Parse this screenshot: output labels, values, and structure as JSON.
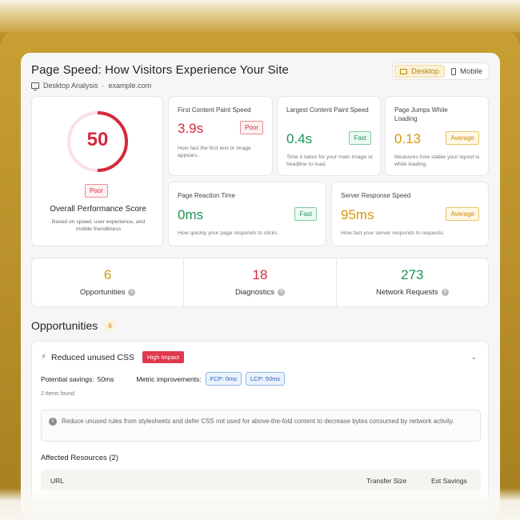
{
  "header": {
    "title": "Page Speed: How Visitors Experience Your Site",
    "analysis_label": "Desktop Analysis",
    "separator": "·",
    "domain": "example.com"
  },
  "device_toggle": {
    "options": [
      "Desktop",
      "Mobile"
    ],
    "selected": "Desktop"
  },
  "score": {
    "value": "50",
    "fraction": 0.5,
    "badge": "Poor",
    "label": "Overall Performance Score",
    "description": "Based on speed, user experience, and mobile friendliness"
  },
  "metrics": [
    {
      "title": "First Content Paint Speed",
      "value": "3.9s",
      "badge": "Poor",
      "description": "How fast the first text or image appears."
    },
    {
      "title": "Largest Content Paint Speed",
      "value": "0.4s",
      "badge": "Fast",
      "description": "Time it takes for your main image or headline to load."
    },
    {
      "title": "Page Jumps While Loading",
      "value": "0.13",
      "badge": "Average",
      "description": "Measures how stable your layout is while loading."
    },
    {
      "title": "Page Reaction Time",
      "value": "0ms",
      "badge": "Fast",
      "description": "How quickly your page responds to clicks."
    },
    {
      "title": "Server Response Speed",
      "value": "95ms",
      "badge": "Average",
      "description": "How fast your server responds to requests."
    }
  ],
  "stats": [
    {
      "value": "6",
      "label": "Opportunities"
    },
    {
      "value": "18",
      "label": "Diagnostics"
    },
    {
      "value": "273",
      "label": "Network Requests"
    }
  ],
  "opportunities": {
    "title": "Opportunities",
    "count": "6",
    "items": [
      {
        "name": "Reduced unused CSS",
        "impact": "High Impact",
        "savings_label": "Potential savings:",
        "savings_value": "50ms",
        "metric_label": "Metric improvements:",
        "metric_chips": [
          "FCP: 0ms",
          "LCP: 50ms"
        ],
        "items_found": "2 items found",
        "info": "Reduce unused rules from stylesheets and defer CSS not used for above-the-fold content to decrease bytes consumed by network activity.",
        "affected_title": "Affected Resources (2)",
        "columns": [
          "URL",
          "Transfer Size",
          "Est Savings"
        ]
      }
    ]
  },
  "colors": {
    "accent": "#d5960f",
    "poor": "#d42a3d",
    "fast": "#1c9457",
    "average": "#d5960f"
  }
}
